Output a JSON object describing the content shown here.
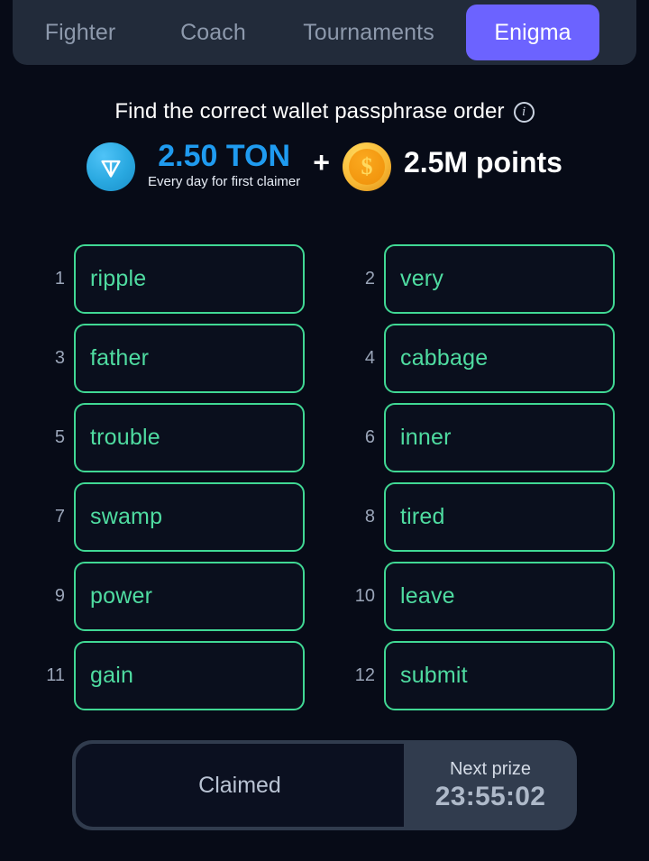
{
  "nav": {
    "tabs": [
      {
        "label": "Fighter",
        "active": false
      },
      {
        "label": "Coach",
        "active": false
      },
      {
        "label": "Tournaments",
        "active": false
      },
      {
        "label": "Enigma",
        "active": true
      }
    ],
    "active_color": "#6c63ff",
    "bar_color": "#222b3a",
    "inactive_text_color": "#8d99ac"
  },
  "headline": {
    "text": "Find the correct wallet passphrase order",
    "info_icon": "info-circle-icon"
  },
  "prize": {
    "ton_icon": "ton-coin-icon",
    "ton_amount": "2.50 TON",
    "ton_amount_color": "#1f9bf0",
    "ton_subtitle": "Every day for first claimer",
    "separator": "+",
    "points_icon": "gold-coin-icon",
    "points_symbol": "$",
    "points_amount": "2.5M points"
  },
  "grid": {
    "border_color": "#40d894",
    "text_color": "#4fdca1",
    "number_color": "#9aa5b8",
    "words": [
      {
        "number": "1",
        "word": "ripple"
      },
      {
        "number": "2",
        "word": "very"
      },
      {
        "number": "3",
        "word": "father"
      },
      {
        "number": "4",
        "word": "cabbage"
      },
      {
        "number": "5",
        "word": "trouble"
      },
      {
        "number": "6",
        "word": "inner"
      },
      {
        "number": "7",
        "word": "swamp"
      },
      {
        "number": "8",
        "word": "tired"
      },
      {
        "number": "9",
        "word": "power"
      },
      {
        "number": "10",
        "word": "leave"
      },
      {
        "number": "11",
        "word": "gain"
      },
      {
        "number": "12",
        "word": "submit"
      }
    ]
  },
  "footer": {
    "claim_label": "Claimed",
    "next_prize_label": "Next prize",
    "timer": "23:55:02"
  }
}
